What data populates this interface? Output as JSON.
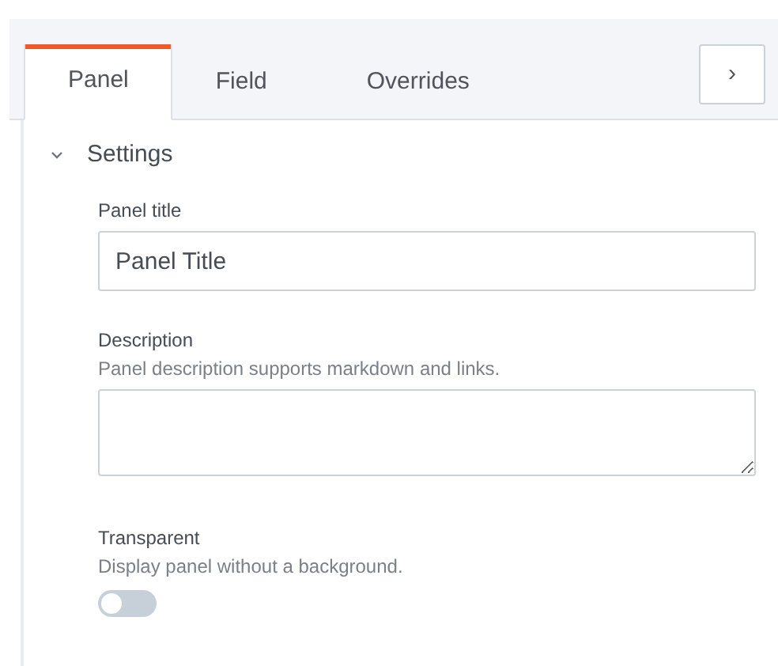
{
  "tabs": [
    {
      "label": "Panel",
      "selected": true
    },
    {
      "label": "Field",
      "selected": false
    },
    {
      "label": "Overrides",
      "selected": false
    }
  ],
  "collapse_button": {
    "label": "›"
  },
  "section": {
    "title": "Settings",
    "expanded": true
  },
  "fields": [
    {
      "kind": "input",
      "label": "Panel title",
      "value": "Panel Title"
    },
    {
      "kind": "textarea",
      "label": "Description",
      "help": "Panel description supports markdown and links."
    },
    {
      "kind": "switch",
      "label": "Transparent",
      "help": "Display panel without a background.",
      "on": false
    }
  ]
}
